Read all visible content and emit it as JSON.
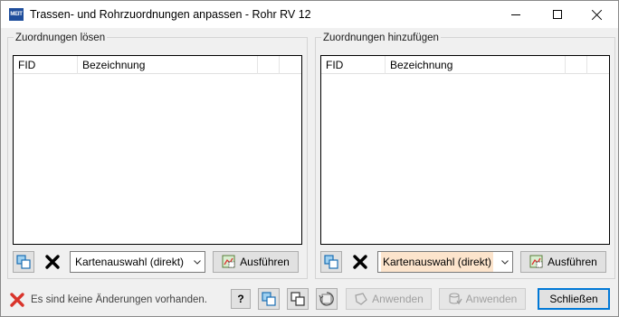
{
  "window": {
    "app_icon_text": "MEIT",
    "title": "Trassen- und Rohrzuordnungen anpassen - Rohr RV 12",
    "controls": [
      "minimize-icon",
      "maximize-icon",
      "close-icon"
    ]
  },
  "left_group": {
    "title": "Zuordnungen lösen",
    "columns": [
      "FID",
      "Bezeichnung",
      "",
      ""
    ],
    "rows": [],
    "select_value": "Kartenauswahl (direkt)",
    "execute_label": "Ausführen"
  },
  "right_group": {
    "title": "Zuordnungen hinzufügen",
    "columns": [
      "FID",
      "Bezeichnung",
      "",
      ""
    ],
    "rows": [],
    "select_value": "Kartenauswahl (direkt)",
    "execute_label": "Ausführen"
  },
  "footer": {
    "status_text": "Es sind keine Änderungen vorhanden.",
    "help_label": "?",
    "apply1_label": "Anwenden",
    "apply2_label": "Anwenden",
    "close_label": "Schließen"
  },
  "colors": {
    "select_highlight": "#fce4cc",
    "delete_x": "#000000",
    "status_x": "#d9342b"
  }
}
